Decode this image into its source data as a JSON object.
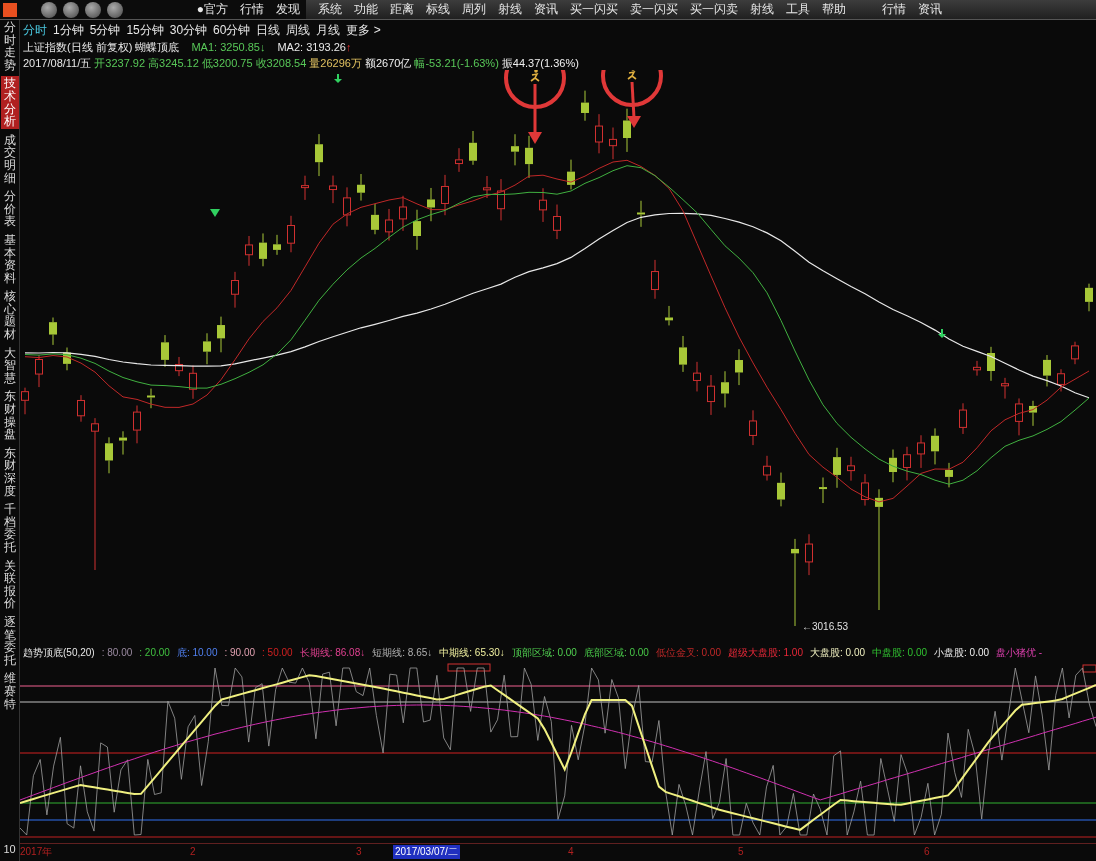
{
  "top_bar": {
    "left_items": [
      "●官方",
      "行情",
      "发现"
    ],
    "menu": [
      "系统",
      "功能",
      "距离",
      "标线",
      "周列",
      "射线",
      "资讯",
      "买一闪买",
      "卖一闪买",
      "买一闪卖",
      "射线",
      "工具",
      "帮助"
    ],
    "right_items": [
      "行情",
      "资讯"
    ]
  },
  "side_tabs": [
    {
      "label": "分时走势",
      "selected": false
    },
    {
      "label": "技术分析",
      "selected": true
    },
    {
      "label": "成交明细",
      "selected": false
    },
    {
      "label": "分价表",
      "selected": false
    },
    {
      "label": "基本资料",
      "selected": false
    },
    {
      "label": "核心题材",
      "selected": false
    },
    {
      "label": "大智慧",
      "selected": false
    },
    {
      "label": "东财操盘",
      "selected": false
    },
    {
      "label": "东财深度",
      "selected": false
    },
    {
      "label": "千档委托",
      "selected": false
    },
    {
      "label": "关联报价",
      "selected": false
    },
    {
      "label": "逐笔委托",
      "selected": false
    },
    {
      "label": "维赛特",
      "selected": false
    }
  ],
  "period_tabs": [
    {
      "label": "分时",
      "selected": true
    },
    {
      "label": "1分钟",
      "selected": false
    },
    {
      "label": "5分钟",
      "selected": false
    },
    {
      "label": "15分钟",
      "selected": false
    },
    {
      "label": "30分钟",
      "selected": false
    },
    {
      "label": "60分钟",
      "selected": false
    },
    {
      "label": "日线",
      "selected": false
    },
    {
      "label": "周线",
      "selected": false
    },
    {
      "label": "月线",
      "selected": false
    },
    {
      "label": "更多 >",
      "selected": false
    }
  ],
  "chart": {
    "title": "上证指数(日线 前复权) 蝴蝶顶底",
    "ma_items": [
      {
        "text": "MA1: 3250.85",
        "arrow": "↓"
      },
      {
        "text": "MA2: 3193.26",
        "arrow": "↑"
      }
    ],
    "info_items": [
      "2017/08/11/五",
      "开3237.92",
      "高3245.12",
      "低3200.75",
      "收3208.54",
      "量26296万",
      "额2670亿",
      "幅-53.21(-1.63%)",
      "振44.37(1.36%)"
    ],
    "low_label": "←3016.53"
  },
  "indicator": {
    "title": "趋势顶底(50,20)",
    "scale_label": "10",
    "items": [
      ": 80.00",
      ": 20.00",
      "底: 10.00",
      ": 90.00",
      ": 50.00",
      "长期线: 86.08↓",
      "短期线: 8.65↓",
      "中期线: 65.30↓",
      "顶部区域: 0.00",
      "底部区域: 0.00",
      "低位金叉: 0.00",
      "超级大盘股: 1.00",
      "大盘股: 0.00",
      "中盘股: 0.00",
      "小盘股: 0.00",
      "盘小猪优 -"
    ]
  },
  "x_axis": [
    {
      "label": "2017年",
      "highlighted": false
    },
    {
      "label": "2",
      "highlighted": false
    },
    {
      "label": "3",
      "highlighted": false
    },
    {
      "label": "2017/03/07/二",
      "highlighted": true
    },
    {
      "label": "4",
      "highlighted": false
    },
    {
      "label": "5",
      "highlighted": false
    },
    {
      "label": "6",
      "highlighted": false
    }
  ]
}
